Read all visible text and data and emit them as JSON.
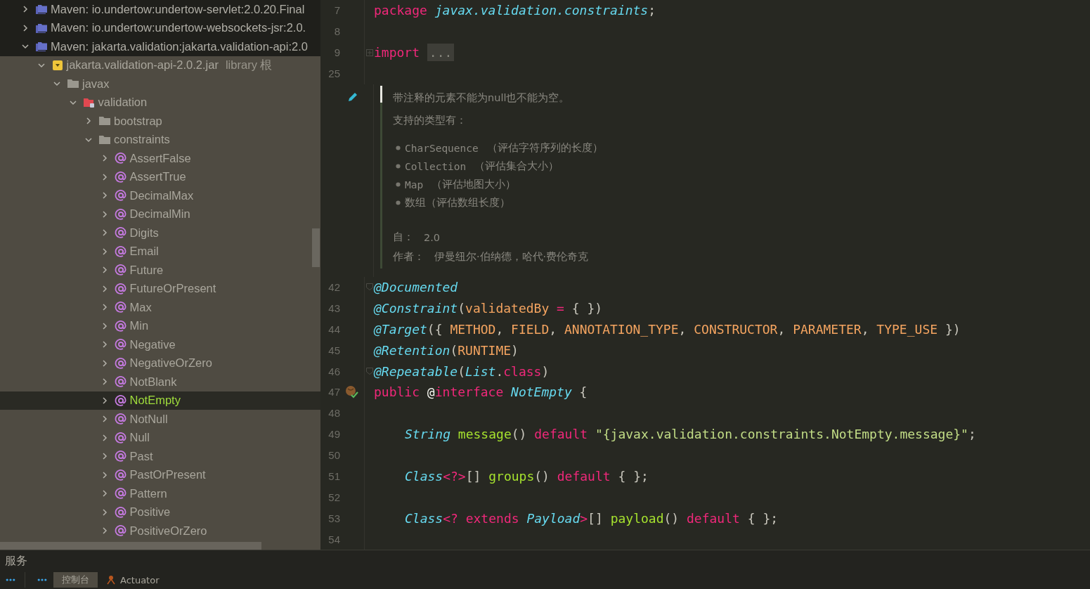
{
  "project_tree": {
    "items": [
      {
        "label": "Maven: io.undertow:undertow-servlet:2.0.20.Final",
        "kind": "module",
        "expanded": false,
        "selected": false
      },
      {
        "label": "Maven: io.undertow:undertow-websockets-jsr:2.0.",
        "kind": "module",
        "expanded": false,
        "selected": false
      },
      {
        "label": "Maven: jakarta.validation:jakarta.validation-api:2.0",
        "kind": "module",
        "expanded": true,
        "selected": false,
        "children": [
          {
            "label": "jakarta.validation-api-2.0.2.jar",
            "suffix": "library 根",
            "kind": "jar",
            "expanded": true,
            "selected": false,
            "children": [
              {
                "label": "javax",
                "kind": "folder",
                "expanded": true,
                "selected": false,
                "children": [
                  {
                    "label": "validation",
                    "kind": "package",
                    "expanded": true,
                    "selected": false,
                    "children": [
                      {
                        "label": "bootstrap",
                        "kind": "folder",
                        "expanded": false,
                        "selected": false
                      },
                      {
                        "label": "constraints",
                        "kind": "folder",
                        "expanded": true,
                        "selected": false,
                        "children": [
                          {
                            "label": "AssertFalse",
                            "kind": "annotation",
                            "expanded": false,
                            "selected": false
                          },
                          {
                            "label": "AssertTrue",
                            "kind": "annotation",
                            "expanded": false,
                            "selected": false
                          },
                          {
                            "label": "DecimalMax",
                            "kind": "annotation",
                            "expanded": false,
                            "selected": false
                          },
                          {
                            "label": "DecimalMin",
                            "kind": "annotation",
                            "expanded": false,
                            "selected": false
                          },
                          {
                            "label": "Digits",
                            "kind": "annotation",
                            "expanded": false,
                            "selected": false
                          },
                          {
                            "label": "Email",
                            "kind": "annotation",
                            "expanded": false,
                            "selected": false
                          },
                          {
                            "label": "Future",
                            "kind": "annotation",
                            "expanded": false,
                            "selected": false
                          },
                          {
                            "label": "FutureOrPresent",
                            "kind": "annotation",
                            "expanded": false,
                            "selected": false
                          },
                          {
                            "label": "Max",
                            "kind": "annotation",
                            "expanded": false,
                            "selected": false
                          },
                          {
                            "label": "Min",
                            "kind": "annotation",
                            "expanded": false,
                            "selected": false
                          },
                          {
                            "label": "Negative",
                            "kind": "annotation",
                            "expanded": false,
                            "selected": false
                          },
                          {
                            "label": "NegativeOrZero",
                            "kind": "annotation",
                            "expanded": false,
                            "selected": false
                          },
                          {
                            "label": "NotBlank",
                            "kind": "annotation",
                            "expanded": false,
                            "selected": false
                          },
                          {
                            "label": "NotEmpty",
                            "kind": "annotation",
                            "expanded": false,
                            "selected": true
                          },
                          {
                            "label": "NotNull",
                            "kind": "annotation",
                            "expanded": false,
                            "selected": false
                          },
                          {
                            "label": "Null",
                            "kind": "annotation",
                            "expanded": false,
                            "selected": false
                          },
                          {
                            "label": "Past",
                            "kind": "annotation",
                            "expanded": false,
                            "selected": false
                          },
                          {
                            "label": "PastOrPresent",
                            "kind": "annotation",
                            "expanded": false,
                            "selected": false
                          },
                          {
                            "label": "Pattern",
                            "kind": "annotation",
                            "expanded": false,
                            "selected": false
                          },
                          {
                            "label": "Positive",
                            "kind": "annotation",
                            "expanded": false,
                            "selected": false
                          },
                          {
                            "label": "PositiveOrZero",
                            "kind": "annotation",
                            "expanded": false,
                            "selected": false
                          }
                        ]
                      }
                    ]
                  }
                ]
              }
            ]
          }
        ]
      }
    ]
  },
  "editor": {
    "head_lines": [
      {
        "number": "7",
        "tokens": [
          {
            "t": "package ",
            "kind": "keyword"
          },
          {
            "t": "javax.validation.constraints",
            "kind": "type"
          },
          {
            "t": ";",
            "kind": "punct"
          }
        ]
      },
      {
        "number": "8"
      },
      {
        "number": "9",
        "foldable": true,
        "tokens": [
          {
            "t": "import ",
            "kind": "keyword"
          },
          {
            "t": "...",
            "kind": "fold"
          }
        ]
      },
      {
        "number": "25"
      }
    ],
    "doc": {
      "paragraphs": [
        "带注释的元素不能为null也不能为空。",
        "支持的类型有："
      ],
      "list": [
        {
          "code": "CharSequence",
          "note": "（评估字符序列的长度）"
        },
        {
          "code": "Collection",
          "note": "（评估集合大小）"
        },
        {
          "code": "Map",
          "note": "（评估地图大小）"
        },
        {
          "note": "数组（评估数组长度）"
        }
      ],
      "tags": [
        {
          "label": "自：",
          "value": "2.0"
        },
        {
          "label": "作者：",
          "value": "伊曼纽尔·伯纳德，哈代·费伦奇克"
        }
      ]
    },
    "lines": [
      {
        "number": "42",
        "foldable": true,
        "tokens": [
          {
            "t": "@Documented",
            "kind": "type"
          }
        ]
      },
      {
        "number": "43",
        "tokens": [
          {
            "t": "@Constraint",
            "kind": "type"
          },
          {
            "t": "(",
            "kind": "punct"
          },
          {
            "t": "validatedBy ",
            "kind": "constant"
          },
          {
            "t": "= ",
            "kind": "keyword"
          },
          {
            "t": "{ })",
            "kind": "punct"
          }
        ]
      },
      {
        "number": "44",
        "tokens": [
          {
            "t": "@Target",
            "kind": "type"
          },
          {
            "t": "({ ",
            "kind": "punct"
          },
          {
            "t": "METHOD",
            "kind": "constant"
          },
          {
            "t": ", ",
            "kind": "punct"
          },
          {
            "t": "FIELD",
            "kind": "constant"
          },
          {
            "t": ", ",
            "kind": "punct"
          },
          {
            "t": "ANNOTATION_TYPE",
            "kind": "constant"
          },
          {
            "t": ", ",
            "kind": "punct"
          },
          {
            "t": "CONSTRUCTOR",
            "kind": "constant"
          },
          {
            "t": ", ",
            "kind": "punct"
          },
          {
            "t": "PARAMETER",
            "kind": "constant"
          },
          {
            "t": ", ",
            "kind": "punct"
          },
          {
            "t": "TYPE_USE",
            "kind": "constant"
          },
          {
            "t": " })",
            "kind": "punct"
          }
        ]
      },
      {
        "number": "45",
        "tokens": [
          {
            "t": "@Retention",
            "kind": "type"
          },
          {
            "t": "(",
            "kind": "punct"
          },
          {
            "t": "RUNTIME",
            "kind": "constant"
          },
          {
            "t": ")",
            "kind": "punct"
          }
        ]
      },
      {
        "number": "46",
        "foldable": true,
        "tokens": [
          {
            "t": "@Repeatable",
            "kind": "type"
          },
          {
            "t": "(",
            "kind": "punct"
          },
          {
            "t": "List",
            "kind": "type"
          },
          {
            "t": ".",
            "kind": "punct"
          },
          {
            "t": "class",
            "kind": "keyword"
          },
          {
            "t": ")",
            "kind": "punct"
          }
        ]
      },
      {
        "number": "47",
        "implemented": true,
        "tokens": [
          {
            "t": "public ",
            "kind": "keyword"
          },
          {
            "t": "@",
            "kind": "plain"
          },
          {
            "t": "interface ",
            "kind": "keyword"
          },
          {
            "t": "NotEmpty",
            "kind": "type"
          },
          {
            "t": " {",
            "kind": "punct"
          }
        ]
      },
      {
        "number": "48"
      },
      {
        "number": "49",
        "indented": true,
        "tokens": [
          {
            "t": "String ",
            "kind": "type"
          },
          {
            "t": "message",
            "kind": "method"
          },
          {
            "t": "() ",
            "kind": "punct"
          },
          {
            "t": "default ",
            "kind": "keyword"
          },
          {
            "t": "\"{javax.validation.constraints.NotEmpty.message}\"",
            "kind": "string"
          },
          {
            "t": ";",
            "kind": "punct"
          }
        ]
      },
      {
        "number": "50"
      },
      {
        "number": "51",
        "indented": true,
        "tokens": [
          {
            "t": "Class",
            "kind": "type"
          },
          {
            "t": "<?>",
            "kind": "keyword"
          },
          {
            "t": "[] ",
            "kind": "punct"
          },
          {
            "t": "groups",
            "kind": "method"
          },
          {
            "t": "() ",
            "kind": "punct"
          },
          {
            "t": "default ",
            "kind": "keyword"
          },
          {
            "t": "{ };",
            "kind": "punct"
          }
        ]
      },
      {
        "number": "52"
      },
      {
        "number": "53",
        "indented": true,
        "tokens": [
          {
            "t": "Class",
            "kind": "type"
          },
          {
            "t": "<? extends ",
            "kind": "keyword"
          },
          {
            "t": "Payload",
            "kind": "type"
          },
          {
            "t": ">",
            "kind": "keyword"
          },
          {
            "t": "[] ",
            "kind": "punct"
          },
          {
            "t": "payload",
            "kind": "method"
          },
          {
            "t": "() ",
            "kind": "punct"
          },
          {
            "t": "default ",
            "kind": "keyword"
          },
          {
            "t": "{ };",
            "kind": "punct"
          }
        ]
      },
      {
        "number": "54"
      }
    ]
  },
  "services_panel": {
    "title": "服务",
    "tabs": [
      {
        "label": "控制台",
        "selected": true,
        "kind": "console"
      },
      {
        "label": "Actuator",
        "selected": false,
        "kind": "actuator"
      }
    ]
  }
}
